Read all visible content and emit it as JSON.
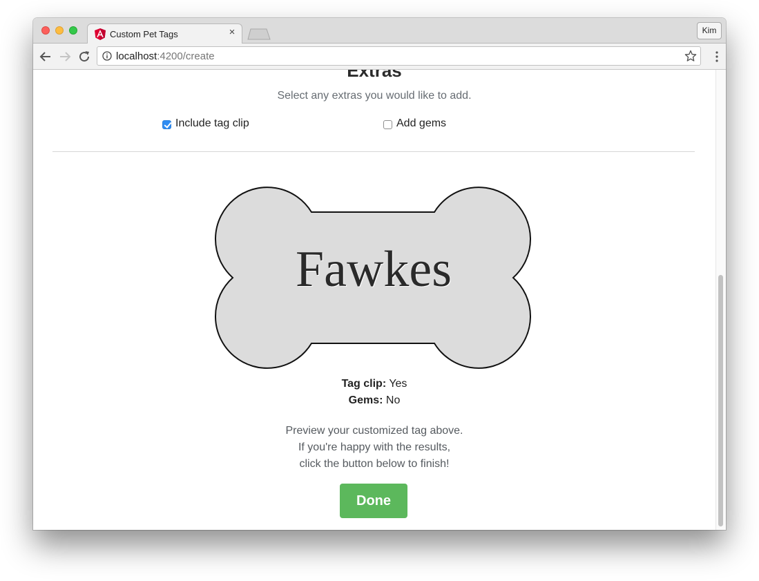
{
  "browser": {
    "tab_title": "Custom Pet Tags",
    "tab_close": "×",
    "profile_label": "Kim",
    "url_host": "localhost",
    "url_path": ":4200/create"
  },
  "extras": {
    "title": "Extras",
    "subtitle": "Select any extras you would like to add.",
    "options": [
      {
        "label": "Include tag clip",
        "checked": true
      },
      {
        "label": "Add gems",
        "checked": false
      }
    ]
  },
  "tag": {
    "name": "Fawkes",
    "fill_color": "#dcdcdc"
  },
  "summary": {
    "tag_clip_label": "Tag clip:",
    "tag_clip_value": "Yes",
    "gems_label": "Gems:",
    "gems_value": "No"
  },
  "preview_text": [
    "Preview your customized tag above.",
    "If you're happy with the results,",
    "click the button below to finish!"
  ],
  "done_button": {
    "label": "Done",
    "color": "#5cb85c"
  }
}
